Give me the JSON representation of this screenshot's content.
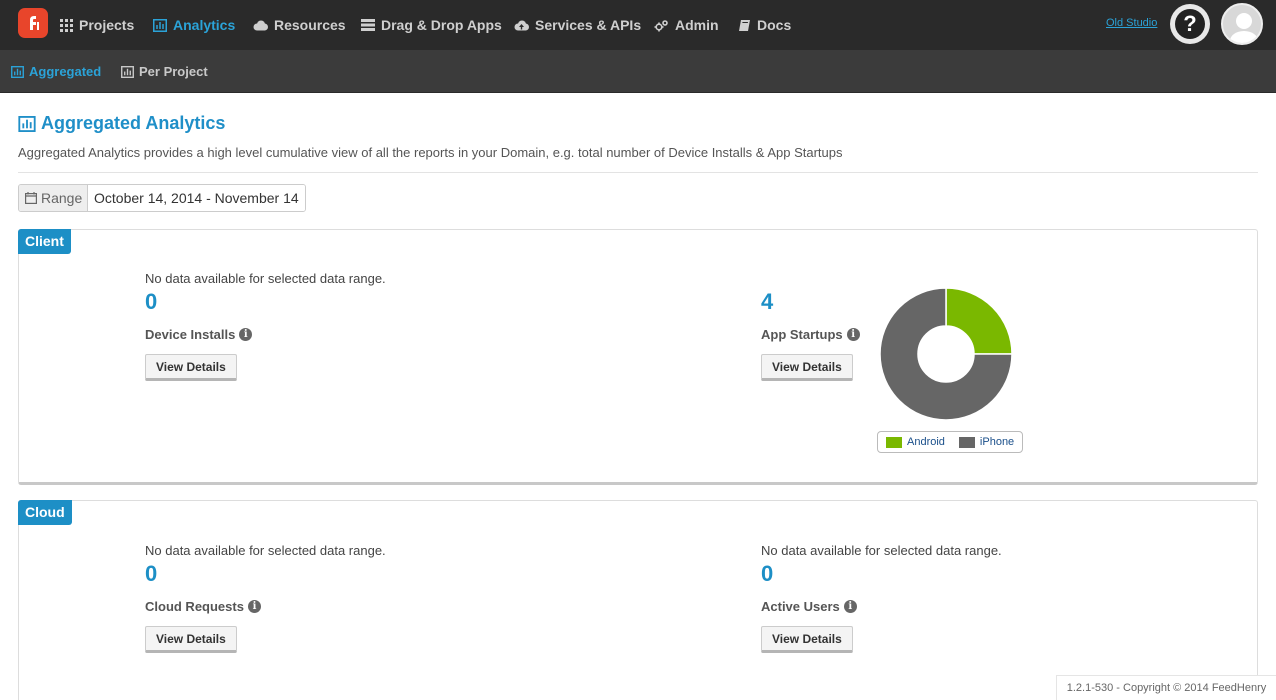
{
  "nav": {
    "items": [
      {
        "label": "Projects",
        "icon": "grid-icon"
      },
      {
        "label": "Analytics",
        "icon": "bar-chart-icon",
        "active": true
      },
      {
        "label": "Resources",
        "icon": "cloud-icon"
      },
      {
        "label": "Drag & Drop Apps",
        "icon": "list-icon"
      },
      {
        "label": "Services & APIs",
        "icon": "cloud-upload-icon"
      },
      {
        "label": "Admin",
        "icon": "gears-icon"
      },
      {
        "label": "Docs",
        "icon": "book-icon"
      }
    ],
    "old_studio": "Old Studio",
    "help_label": "?"
  },
  "subnav": {
    "items": [
      {
        "label": "Aggregated",
        "active": true
      },
      {
        "label": "Per Project"
      }
    ]
  },
  "page": {
    "title": "Aggregated Analytics",
    "description": "Aggregated Analytics provides a high level cumulative view of all the reports in your Domain, e.g. total number of Device Installs & App Startups"
  },
  "range": {
    "label": "Range",
    "value": "October 14, 2014 - November 14"
  },
  "client": {
    "tag": "Client",
    "device_installs": {
      "nodata": "No data available for selected data range.",
      "value": "0",
      "label": "Device Installs",
      "button": "View Details"
    },
    "app_startups": {
      "nodata": "",
      "value": "4",
      "label": "App Startups",
      "button": "View Details"
    }
  },
  "cloud": {
    "tag": "Cloud",
    "cloud_requests": {
      "nodata": "No data available for selected data range.",
      "value": "0",
      "label": "Cloud Requests",
      "button": "View Details"
    },
    "active_users": {
      "nodata": "No data available for selected data range.",
      "value": "0",
      "label": "Active Users",
      "button": "View Details"
    }
  },
  "chart_data": {
    "type": "pie",
    "categories": [
      "Android",
      "iPhone"
    ],
    "values": [
      1,
      3
    ],
    "colors": [
      "#7ab800",
      "#666666"
    ],
    "legend": "bottom"
  },
  "footer": "1.2.1-530 - Copyright © 2014 FeedHenry",
  "colors": {
    "accent": "#1d8fc6",
    "nav_bg": "#2a2a2a",
    "logo": "#e8452b"
  }
}
